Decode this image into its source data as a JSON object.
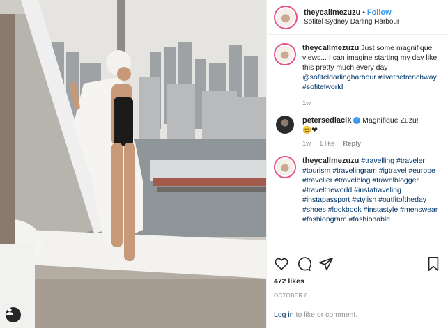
{
  "header": {
    "username": "theycallmezuzu",
    "separator": "•",
    "follow_label": "Follow",
    "location": "Sofitel Sydney Darling Harbour"
  },
  "caption": {
    "username": "theycallmezuzu",
    "text_part1": "Just some magnifique views... I can imagine starting my day like this pretty much every day",
    "mention": "@sofiteldarlingharbour",
    "tag1": "#livethefrenchway",
    "tag2": "#sofitelworld",
    "time": "1w"
  },
  "comment1": {
    "username": "petersedlacik",
    "verified_mark": "✓",
    "text": "Magnifique Zuzu!",
    "emoji": "😊❤",
    "time": "1w",
    "likes": "1 like",
    "reply": "Reply"
  },
  "comment2": {
    "username": "theycallmezuzu",
    "tags": [
      "#travelling",
      "#traveler",
      "#tourism",
      "#travelingram",
      "#igtravel",
      "#europe",
      "#traveller",
      "#travelblog",
      "#travelblogger",
      "#traveltheworld",
      "#instatraveling",
      "#instapassport",
      "#stylish",
      "#outfitoftheday",
      "#shoes",
      "#lookbook",
      "#instastyle",
      "#menswear",
      "#fashiongram",
      "#fashionable"
    ]
  },
  "actions": {
    "likes": "472 likes",
    "date": "OCTOBER 8"
  },
  "login": {
    "link": "Log in",
    "rest": "to like or comment."
  },
  "icons": [
    "user-tag-icon",
    "heart-icon",
    "comment-icon",
    "share-icon",
    "bookmark-icon"
  ],
  "colors": {
    "follow": "#3897f0",
    "hashtag": "#003569",
    "muted": "#8e8e8e",
    "ring": "#e8508a"
  }
}
